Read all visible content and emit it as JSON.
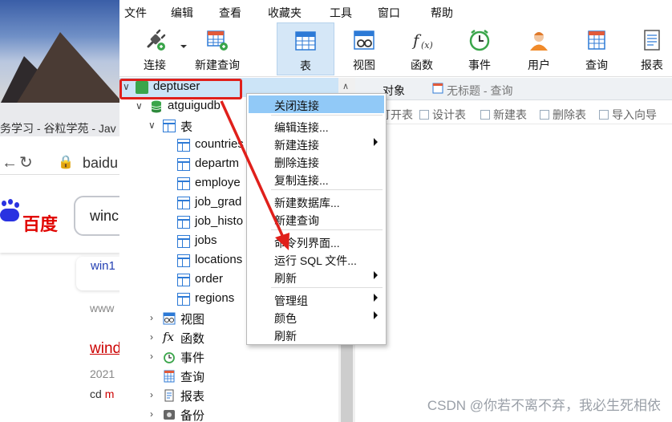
{
  "background_browser": {
    "tab_text": "务学习 - 谷粒学苑 - Jav",
    "url_text": "baidu",
    "baidu_logo": "百度",
    "search_text": "winc",
    "result_link": "win1",
    "result_www": "www",
    "result_title": "wind",
    "result_date": "2021",
    "result_snippet_cd": "cd",
    "result_snippet_m": "m"
  },
  "menu": [
    "文件",
    "编辑",
    "查看",
    "收藏夹",
    "工具",
    "窗口",
    "帮助"
  ],
  "toolbar": {
    "connect": "连接",
    "new_query": "新建查询",
    "table": "表",
    "view": "视图",
    "function": "函数",
    "event": "事件",
    "user": "用户",
    "query": "查询",
    "report": "报表"
  },
  "tree": {
    "connection": "deptuser",
    "database": "atguigudb",
    "tables_group": "表",
    "tables": [
      "countries",
      "departm",
      "employe",
      "job_grad",
      "job_histo",
      "jobs",
      "locations",
      "order",
      "regions"
    ],
    "views": "视图",
    "functions": "函数",
    "events": "事件",
    "queries": "查询",
    "reports": "报表",
    "backups": "备份"
  },
  "tabs": {
    "objects": "对象",
    "untitled": "无标题 - 查询"
  },
  "subtoolbar": {
    "open_table": "打开表",
    "design_table": "设计表",
    "new_table": "新建表",
    "delete_table": "删除表",
    "import_wizard": "导入向导"
  },
  "context_menu": {
    "close_connection": "关闭连接",
    "edit_connection": "编辑连接...",
    "new_connection": "新建连接",
    "delete_connection": "删除连接",
    "copy_connection": "复制连接...",
    "new_database": "新建数据库...",
    "new_query": "新建查询",
    "command_line": "命令列界面...",
    "run_sql_file": "运行 SQL 文件...",
    "refresh": "刷新",
    "manage_group": "管理组",
    "color": "颜色",
    "refresh2": "刷新"
  },
  "watermark": "CSDN @你若不离不弃，我必生死相依",
  "colors": {
    "highlight": "#91c9f7",
    "selection": "#cce4f7",
    "annotation_red": "#e0201b",
    "accent_blue": "#2d7ad6"
  }
}
